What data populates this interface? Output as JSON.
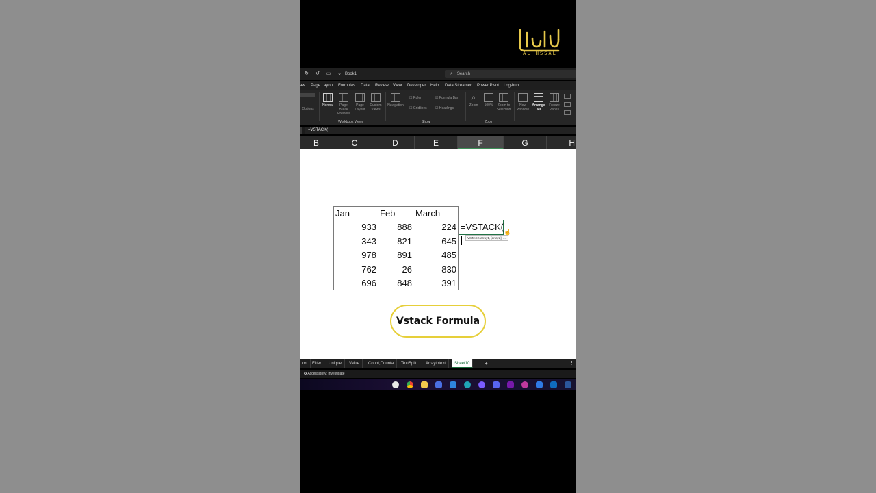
{
  "logo": {
    "arabic_text": "الهسال",
    "latin_text": "AL HSSAL"
  },
  "app": {
    "book_title": "Book1",
    "search_placeholder": "Search",
    "quick_access_icons": [
      "redo-icon",
      "undo-icon",
      "touch-mode-icon",
      "customize-icon"
    ]
  },
  "ribbon_tabs": [
    "aw",
    "Page Layout",
    "Formulas",
    "Data",
    "Review",
    "View",
    "Developer",
    "Help",
    "Data Streamer",
    "Power Pivot",
    "Log-hub"
  ],
  "active_ribbon_tab": "View",
  "ribbon": {
    "options_label": "Options",
    "workbook_views_group": "Workbook Views",
    "normal": "Normal",
    "page_break_preview": "Page Break Preview",
    "page_layout": "Page Layout",
    "custom_views": "Custom Views",
    "navigation": "Navigation",
    "show_group": "Show",
    "ruler": "Ruler",
    "gridlines": "Gridlines",
    "formula_bar": "Formula Bar",
    "headings": "Headings",
    "zoom_group": "Zoom",
    "zoom": "Zoom",
    "zoom_100": "100%",
    "zoom_to_selection": "Zoom to Selection",
    "new_window": "New Window",
    "arrange_all": "Arrange All",
    "freeze_panes": "Freeze Panes"
  },
  "formula_bar": {
    "content": "=VSTACK("
  },
  "column_headers": [
    "B",
    "C",
    "D",
    "E",
    "F",
    "G",
    "H"
  ],
  "selected_column": "F",
  "sheet_table": {
    "headers": [
      "Jan",
      "Feb",
      "March"
    ],
    "rows": [
      [
        "933",
        "888",
        "224"
      ],
      [
        "343",
        "821",
        "645"
      ],
      [
        "978",
        "891",
        "485"
      ],
      [
        "762",
        "26",
        "830"
      ],
      [
        "696",
        "848",
        "391"
      ]
    ]
  },
  "active_cell": {
    "content": "=VSTACK("
  },
  "tooltip": {
    "text": "VSTACK(array1, [array2], ...)"
  },
  "callout": {
    "label": "Vstack Formula"
  },
  "sheet_tabs": [
    "ort",
    "Filter",
    "Unique",
    "Value",
    "Count,Counta",
    "TextSplit",
    "Arraytotext",
    "Sheet10"
  ],
  "active_sheet_tab": "Sheet10",
  "add_sheet": "+",
  "status_bar": {
    "accessibility": "Accessibility: Investigate"
  },
  "colors": {
    "accent_green": "#217346",
    "logo_gold": "#e6c84a",
    "callout_border": "#e6cf3a"
  }
}
